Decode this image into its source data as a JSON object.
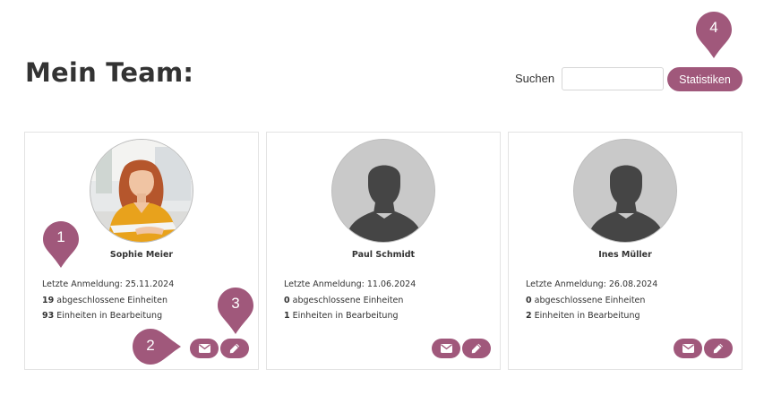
{
  "page": {
    "title": "Mein Team:"
  },
  "search": {
    "label": "Suchen",
    "value": "",
    "placeholder": ""
  },
  "toolbar": {
    "stats_label": "Statistiken"
  },
  "markers": [
    "1",
    "2",
    "3",
    "4"
  ],
  "team": [
    {
      "name": "Sophie Meier",
      "last_login_label": "Letzte Anmeldung: 25.11.2024",
      "completed_count": "19",
      "completed_label": " abgeschlossene Einheiten",
      "in_progress_count": "93",
      "in_progress_label": " Einheiten in Bearbeitung",
      "avatar": "photo"
    },
    {
      "name": "Paul Schmidt",
      "last_login_label": "Letzte Anmeldung: 11.06.2024",
      "completed_count": "0",
      "completed_label": " abgeschlossene Einheiten",
      "in_progress_count": "1",
      "in_progress_label": " Einheiten in Bearbeitung",
      "avatar": "placeholder"
    },
    {
      "name": "Ines Müller",
      "last_login_label": "Letzte Anmeldung: 26.08.2024",
      "completed_count": "0",
      "completed_label": " abgeschlossene Einheiten",
      "in_progress_count": "2",
      "in_progress_label": " Einheiten in Bearbeitung",
      "avatar": "placeholder"
    }
  ],
  "icons": {
    "mail": "envelope-icon",
    "edit": "pencil-icon",
    "avatar_placeholder": "person-silhouette-icon"
  },
  "colors": {
    "accent": "#a0587b",
    "text": "#333333",
    "card_border": "#e3e3e3"
  }
}
